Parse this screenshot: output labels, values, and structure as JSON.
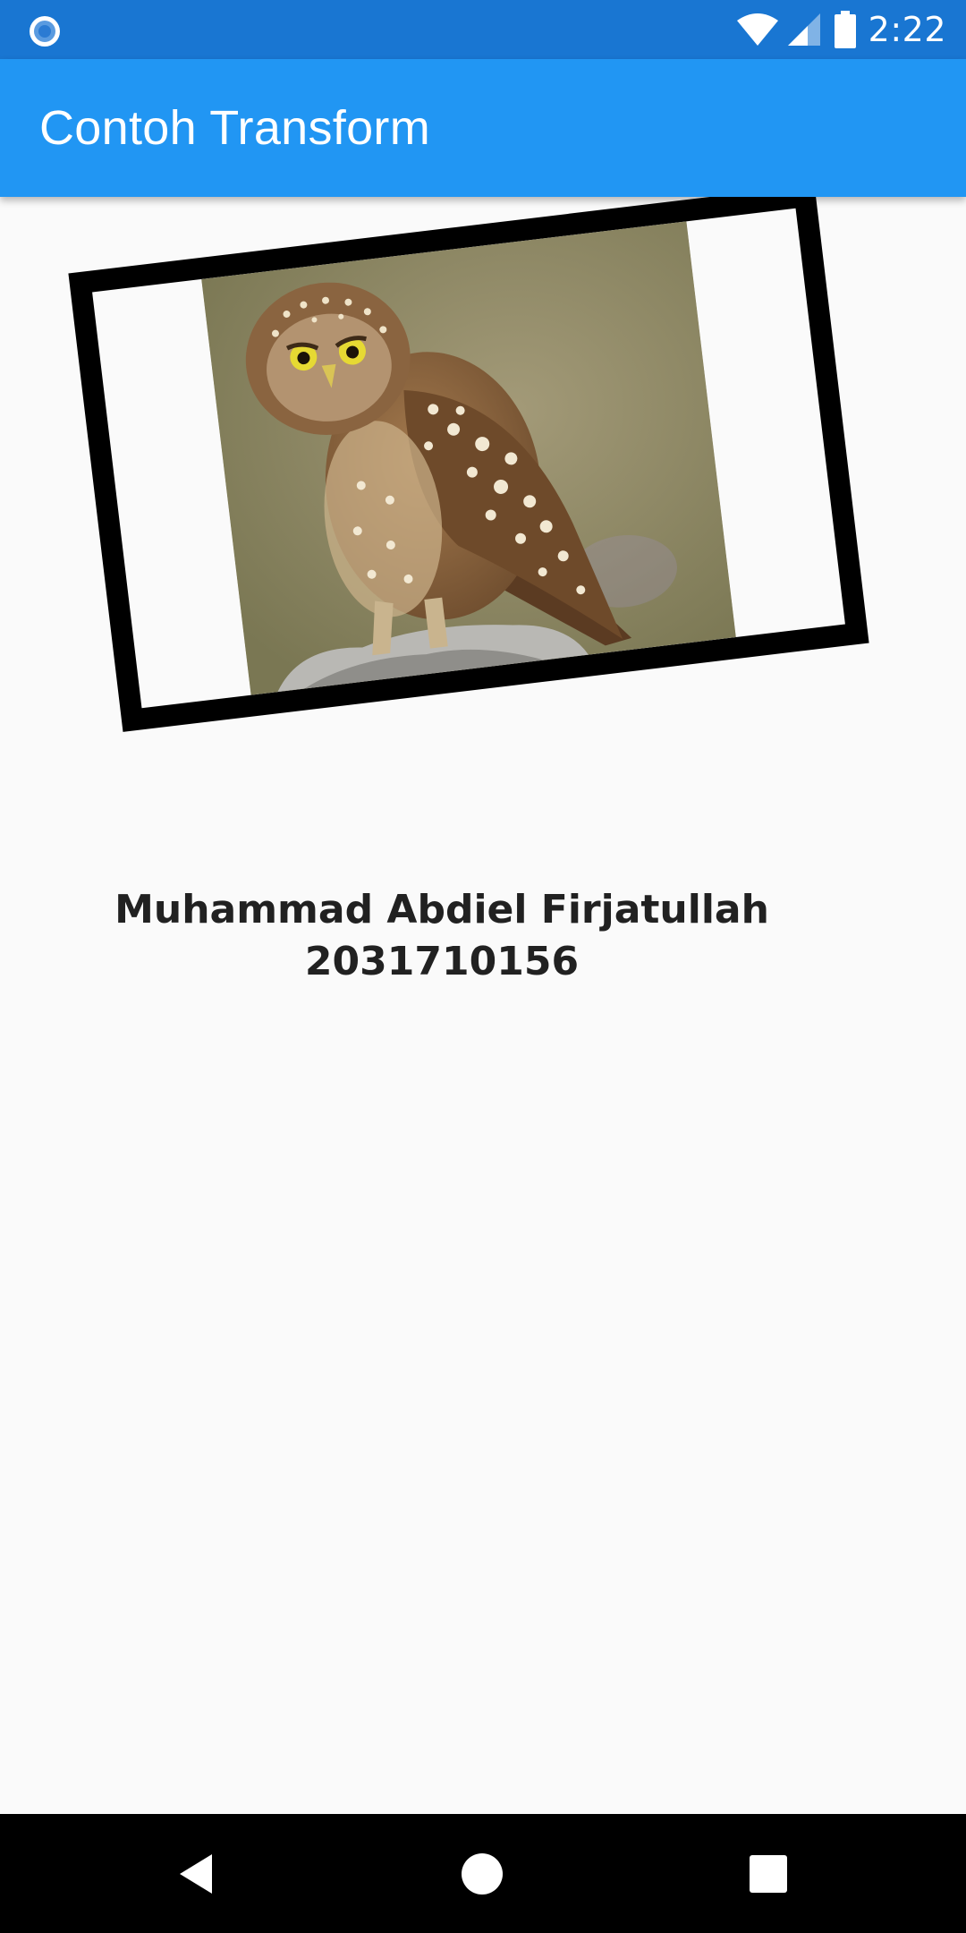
{
  "status_bar": {
    "time": "2:22",
    "icons": [
      "notification-ring-icon",
      "wifi-icon",
      "cell-signal-icon",
      "battery-icon"
    ]
  },
  "app_bar": {
    "title": "Contoh Transform"
  },
  "main": {
    "image": {
      "subject": "owl-photo"
    },
    "name": "Muhammad Abdiel Firjatullah",
    "student_id": "2031710156"
  },
  "nav_bar": {
    "icons": [
      "back-icon",
      "home-icon",
      "recents-icon"
    ]
  },
  "colors": {
    "status_bar": "#1976d2",
    "app_bar": "#2196f3",
    "background": "#fafafa",
    "frame_border": "#000000",
    "text": "#212121"
  }
}
